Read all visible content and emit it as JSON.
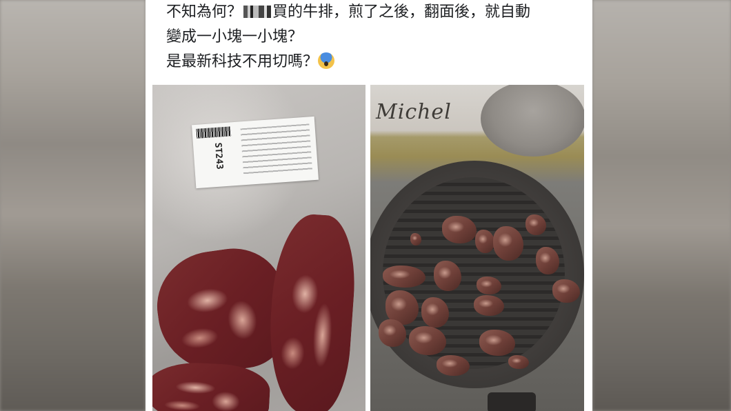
{
  "post": {
    "text_lines": [
      {
        "before": "不知為何？",
        "after": "買的牛排，煎了之後，翻面後，就自動"
      },
      {
        "text": "變成一小塊一小塊？"
      },
      {
        "text": "是最新科技不用切嗎？"
      }
    ],
    "emoji": "screaming-face-emoji"
  },
  "photo_left": {
    "label_code": "ST243"
  },
  "photo_right": {
    "brand": "Michel"
  }
}
